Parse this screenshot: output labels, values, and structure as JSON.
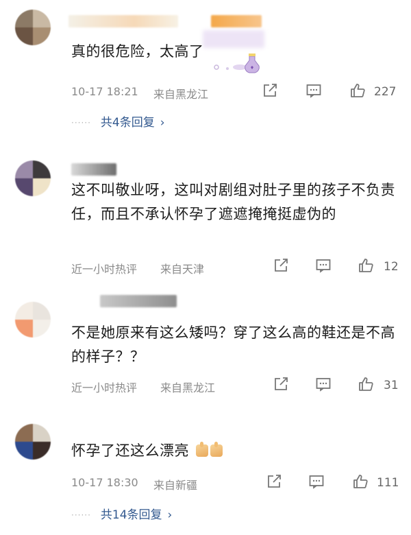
{
  "comments": [
    {
      "text": "真的很危险，太高了",
      "time": "10-17 18:21",
      "from": "来自黑龙江",
      "likes": "227",
      "replies": "共4条回复"
    },
    {
      "text": "这不叫敬业呀，这叫对剧组对肚子里的孩子不负责任，而且不承认怀孕了遮遮掩掩挺虚伪的",
      "time": "近一小时热评",
      "from": "来自天津",
      "likes": "12"
    },
    {
      "text": "不是她原来有这么矮吗？穿了这么高的鞋还是不高的样子？？",
      "time": "近一小时热评",
      "from": "来自黑龙江",
      "likes": "31"
    },
    {
      "text": "怀孕了还这么漂亮",
      "time": "10-17 18:30",
      "from": "来自新疆",
      "likes": "111",
      "replies": "共14条回复"
    }
  ],
  "icons": {
    "share": "share-icon",
    "comment": "comment-icon",
    "like": "thumbs-up-icon",
    "chevron": "chevron-right-icon"
  },
  "colors": {
    "link": "#33598f",
    "meta": "#8a8a8a"
  }
}
